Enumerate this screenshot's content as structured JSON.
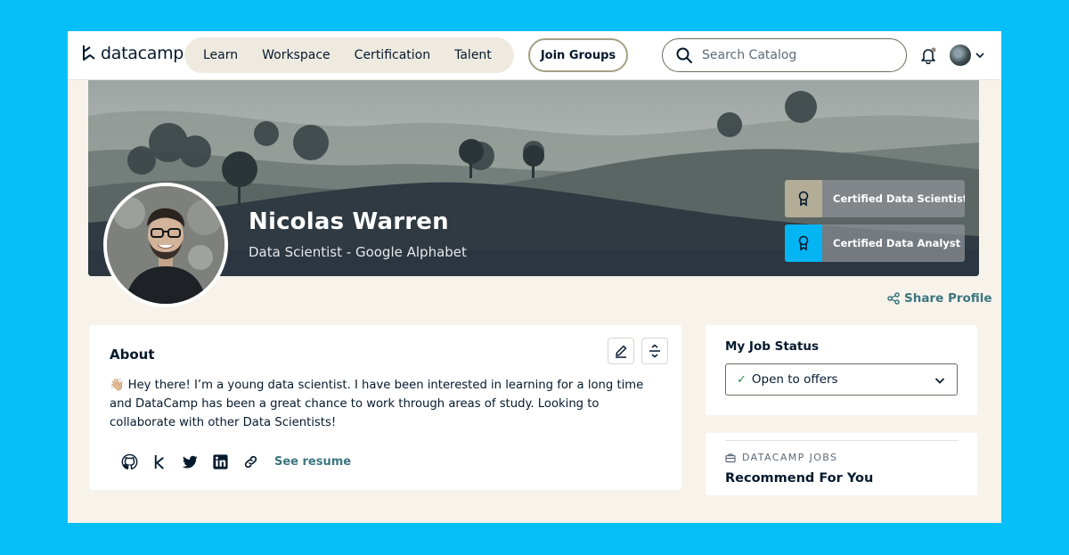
{
  "nav": {
    "logo_text": "datacamp",
    "links": [
      "Learn",
      "Workspace",
      "Certification",
      "Talent"
    ],
    "join_groups": "Join Groups",
    "search_placeholder": "Search Catalog"
  },
  "profile": {
    "name": "Nicolas Warren",
    "role": "Data Scientist - Google Alphabet",
    "certifications": [
      {
        "label": "Certified Data Scientist",
        "color": "#B3AD96"
      },
      {
        "label": "Certified Data Analyst",
        "color": "#03B5F2"
      }
    ],
    "share_label": "Share Profile"
  },
  "about": {
    "title": "About",
    "emoji": "👋🏼",
    "text": "Hey there! I’m a young data scientist. I have been interested in learning for a long time and DataCamp has been a great chance to work through areas of study. Looking to collaborate with other Data Scientists!",
    "socials": [
      "github-icon",
      "kaggle-icon",
      "twitter-icon",
      "linkedin-icon",
      "link-icon"
    ],
    "see_resume": "See resume"
  },
  "job_status": {
    "title": "My Job Status",
    "value": "Open to offers"
  },
  "jobs": {
    "kicker": "DATACAMP JOBS",
    "title": "Recommend For You"
  },
  "colors": {
    "frame": "#05BFF9",
    "page_bg": "#F7F3EB",
    "link_teal": "#3B7680",
    "navy": "#05192D"
  }
}
